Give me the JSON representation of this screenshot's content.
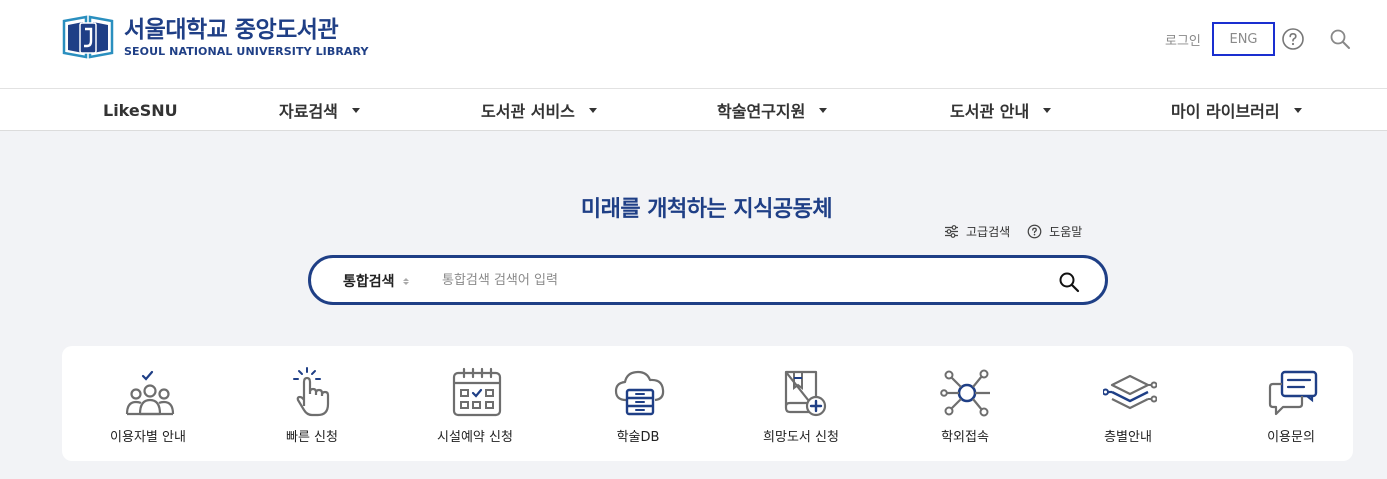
{
  "header": {
    "logo_ko": "서울대학교 중앙도서관",
    "logo_en": "SEOUL NATIONAL UNIVERSITY LIBRARY",
    "login": "로그인",
    "eng": "ENG",
    "icons": {
      "help": "help-circle-icon",
      "search": "search-icon"
    },
    "colors": {
      "brand": "#1f3f86",
      "focus": "#1a2fd0"
    }
  },
  "gnb": {
    "items": [
      {
        "label": "LikeSNU",
        "has_dropdown": false
      },
      {
        "label": "자료검색",
        "has_dropdown": true
      },
      {
        "label": "도서관 서비스",
        "has_dropdown": true
      },
      {
        "label": "학술연구지원",
        "has_dropdown": true
      },
      {
        "label": "도서관 안내",
        "has_dropdown": true
      },
      {
        "label": "마이 라이브러리",
        "has_dropdown": true
      }
    ]
  },
  "hero": {
    "title": "미래를 개척하는 지식공동체",
    "advanced_search": "고급검색",
    "help": "도움말"
  },
  "search": {
    "scope": "통합검색",
    "placeholder": "통합검색 검색어 입력"
  },
  "quick_menu": {
    "items": [
      {
        "label": "이용자별 안내",
        "icon": "users-check-icon"
      },
      {
        "label": "빠른 신청",
        "icon": "tap-hand-icon"
      },
      {
        "label": "시설예약 신청",
        "icon": "calendar-icon"
      },
      {
        "label": "학술DB",
        "icon": "cloud-database-icon"
      },
      {
        "label": "희망도서 신청",
        "icon": "book-add-icon"
      },
      {
        "label": "학외접속",
        "icon": "network-icon"
      },
      {
        "label": "층별안내",
        "icon": "layers-icon"
      },
      {
        "label": "이용문의",
        "icon": "chat-icon"
      }
    ]
  }
}
